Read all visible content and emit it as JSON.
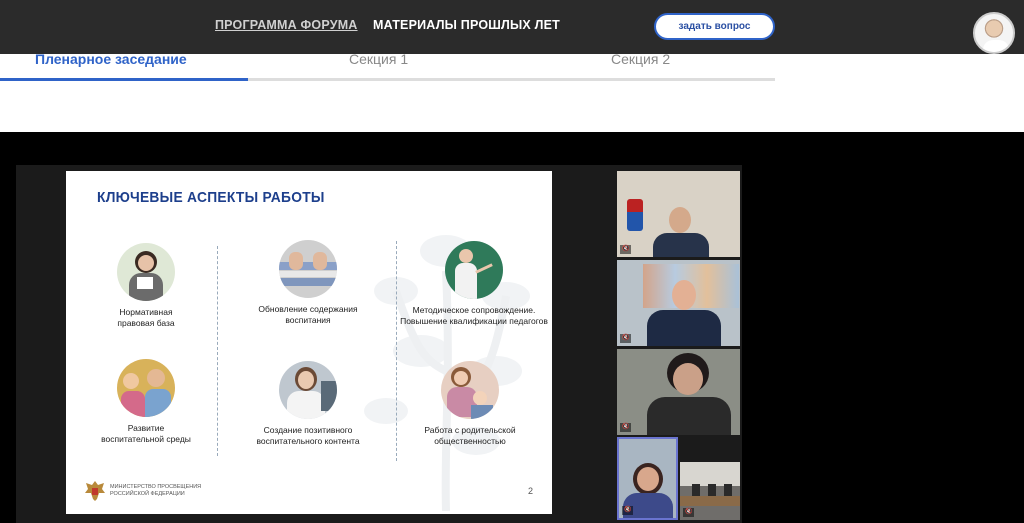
{
  "header": {
    "nav": [
      {
        "label": "ПРОГРАММА ФОРУМА"
      },
      {
        "label": "МАТЕРИАЛЫ ПРОШЛЫХ ЛЕТ"
      }
    ],
    "ask_button": "задать вопрос"
  },
  "tabs": [
    {
      "label": "Пленарное заседание"
    },
    {
      "label": "Секция 1"
    },
    {
      "label": "Секция 2"
    }
  ],
  "slide": {
    "title": "КЛЮЧЕВЫЕ АСПЕКТЫ РАБОТЫ",
    "aspects": [
      {
        "line1": "Нормативная",
        "line2": "правовая база"
      },
      {
        "line1": "Обновление содержания",
        "line2": "воспитания"
      },
      {
        "line1": "Методическое сопровождение.",
        "line2": "Повышение квалификации педагогов"
      },
      {
        "line1": "Развитие",
        "line2": "воспитательной среды"
      },
      {
        "line1": "Создание позитивного",
        "line2": "воспитательного контента"
      },
      {
        "line1": "Работа с родительской",
        "line2": "общественностью"
      }
    ],
    "logo_line1": "МИНИСТЕРСТВО ПРОСВЕЩЕНИЯ",
    "logo_line2": "РОССИЙСКОЙ ФЕДЕРАЦИИ",
    "page_number": "2"
  },
  "participants": [
    {
      "badge": "🔇"
    },
    {
      "badge": "🔇"
    },
    {
      "badge": "🔇"
    },
    {
      "badge": "🔇"
    },
    {
      "badge": "🔇"
    }
  ]
}
